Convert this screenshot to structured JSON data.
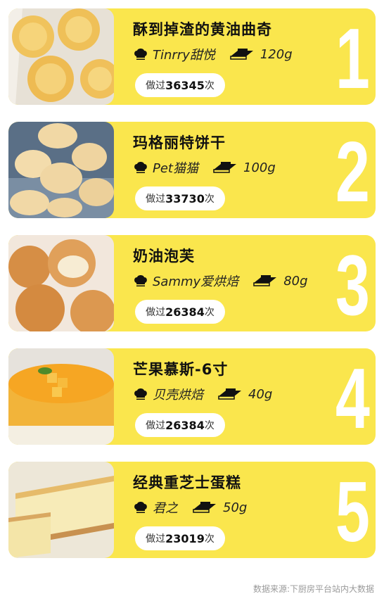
{
  "colors": {
    "card_bg": "#fae64d",
    "rank": "#ffffff",
    "text": "#111111"
  },
  "cards": [
    {
      "rank": "1",
      "title": "酥到掉渣的黄油曲奇",
      "author": "Tinrry甜悦",
      "weight": "120g",
      "made_prefix": "做过",
      "made_count": "36345",
      "made_suffix": "次",
      "image": "butter-cookies"
    },
    {
      "rank": "2",
      "title": "玛格丽特饼干",
      "author": "Pet猫猫",
      "weight": "100g",
      "made_prefix": "做过",
      "made_count": "33730",
      "made_suffix": "次",
      "image": "margherita-biscuits"
    },
    {
      "rank": "3",
      "title": "奶油泡芙",
      "author": "Sammy爱烘焙",
      "weight": "80g",
      "made_prefix": "做过",
      "made_count": "26384",
      "made_suffix": "次",
      "image": "cream-puffs"
    },
    {
      "rank": "4",
      "title": "芒果慕斯-6寸",
      "author": "贝壳烘焙",
      "weight": "40g",
      "made_prefix": "做过",
      "made_count": "26384",
      "made_suffix": "次",
      "image": "mango-mousse"
    },
    {
      "rank": "5",
      "title": "经典重芝士蛋糕",
      "author": "君之",
      "weight": "50g",
      "made_prefix": "做过",
      "made_count": "23019",
      "made_suffix": "次",
      "image": "cheesecake"
    }
  ],
  "footer": "数据来源:下厨房平台站内大数据"
}
